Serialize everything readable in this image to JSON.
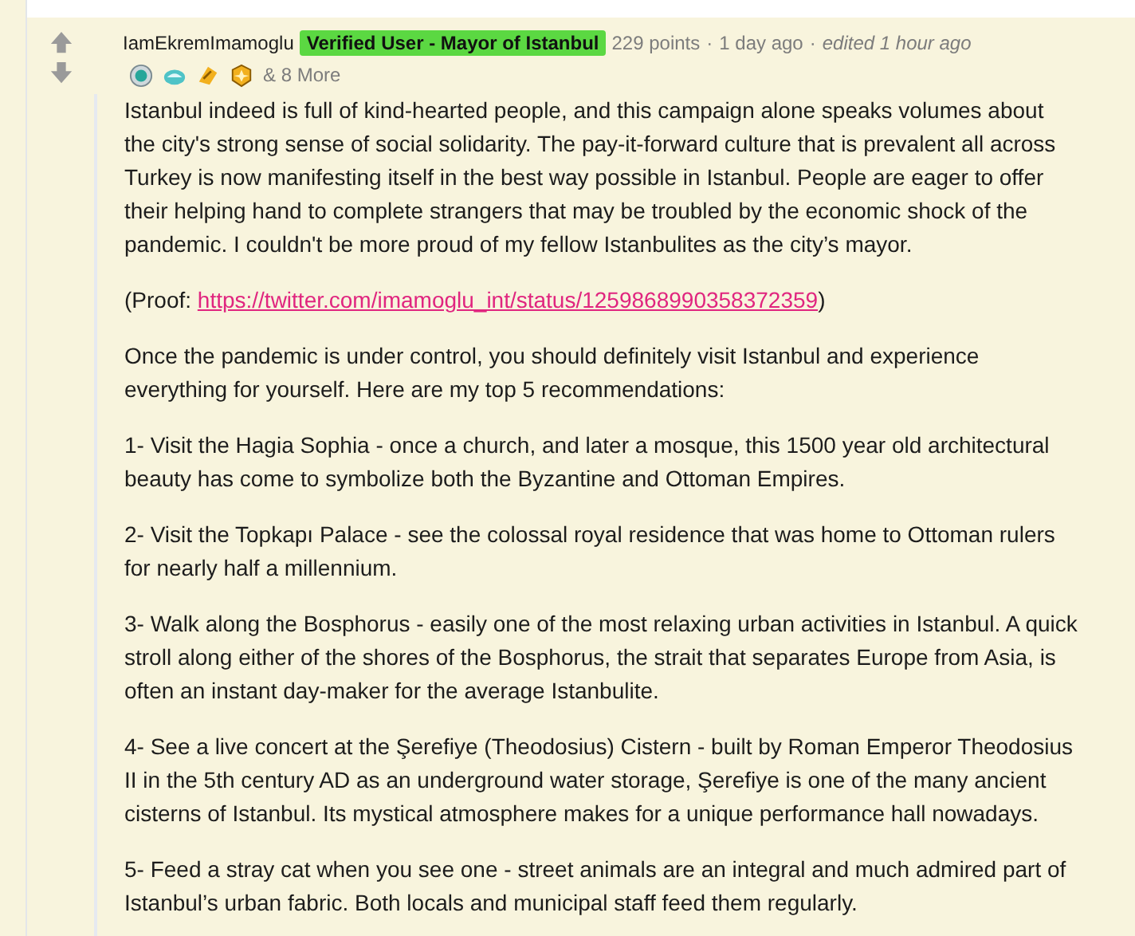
{
  "comment": {
    "author": "IamEkremImamoglu",
    "flair": "Verified User - Mayor of Istanbul",
    "points": "229 points",
    "separator_1": "·",
    "time": "1 day ago",
    "separator_2": "·",
    "edited": "edited 1 hour ago",
    "awards_more": "& 8 More",
    "paragraphs": [
      {
        "kind": "text",
        "text": "Istanbul indeed is full of kind-hearted people, and this campaign alone speaks volumes about the city's strong sense of social solidarity. The pay-it-forward culture that is prevalent all across Turkey is now manifesting itself in the best way possible in Istanbul. People are eager to offer their helping hand to complete strangers that may be troubled by the economic shock of the pandemic. I couldn't be more proud of my fellow Istanbulites as the city’s mayor."
      },
      {
        "kind": "link",
        "before": "(Proof: ",
        "link": "https://twitter.com/imamoglu_int/status/1259868990358372359",
        "after": ")"
      },
      {
        "kind": "text",
        "text": "Once the pandemic is under control, you should definitely visit Istanbul and experience everything for yourself. Here are my top 5 recommendations:"
      },
      {
        "kind": "text",
        "text": "1- Visit the Hagia Sophia - once a church, and later a mosque, this 1500 year old architectural beauty has come to symbolize both the Byzantine and Ottoman Empires."
      },
      {
        "kind": "text",
        "text": "2- Visit the Topkapı Palace - see the colossal royal residence that was home to Ottoman rulers for nearly half a millennium."
      },
      {
        "kind": "text",
        "text": "3- Walk along the Bosphorus - easily one of the most relaxing urban activities in Istanbul. A quick stroll along either of the shores of the Bosphorus, the strait that separates Europe from Asia, is often an instant day-maker for the average Istanbulite."
      },
      {
        "kind": "text",
        "text": "4- See a live concert at the Şerefiye (Theodosius) Cistern - built by Roman Emperor Theodosius II in the 5th century AD as an underground water storage, Şerefiye is one of the many ancient cisterns of Istanbul. Its mystical atmosphere makes for a unique performance hall nowadays."
      },
      {
        "kind": "text",
        "text": "5- Feed a stray cat when you see one - street animals are an integral and much admired part of Istanbul’s urban fabric. Both locals and municipal staff feed them regularly."
      }
    ]
  }
}
